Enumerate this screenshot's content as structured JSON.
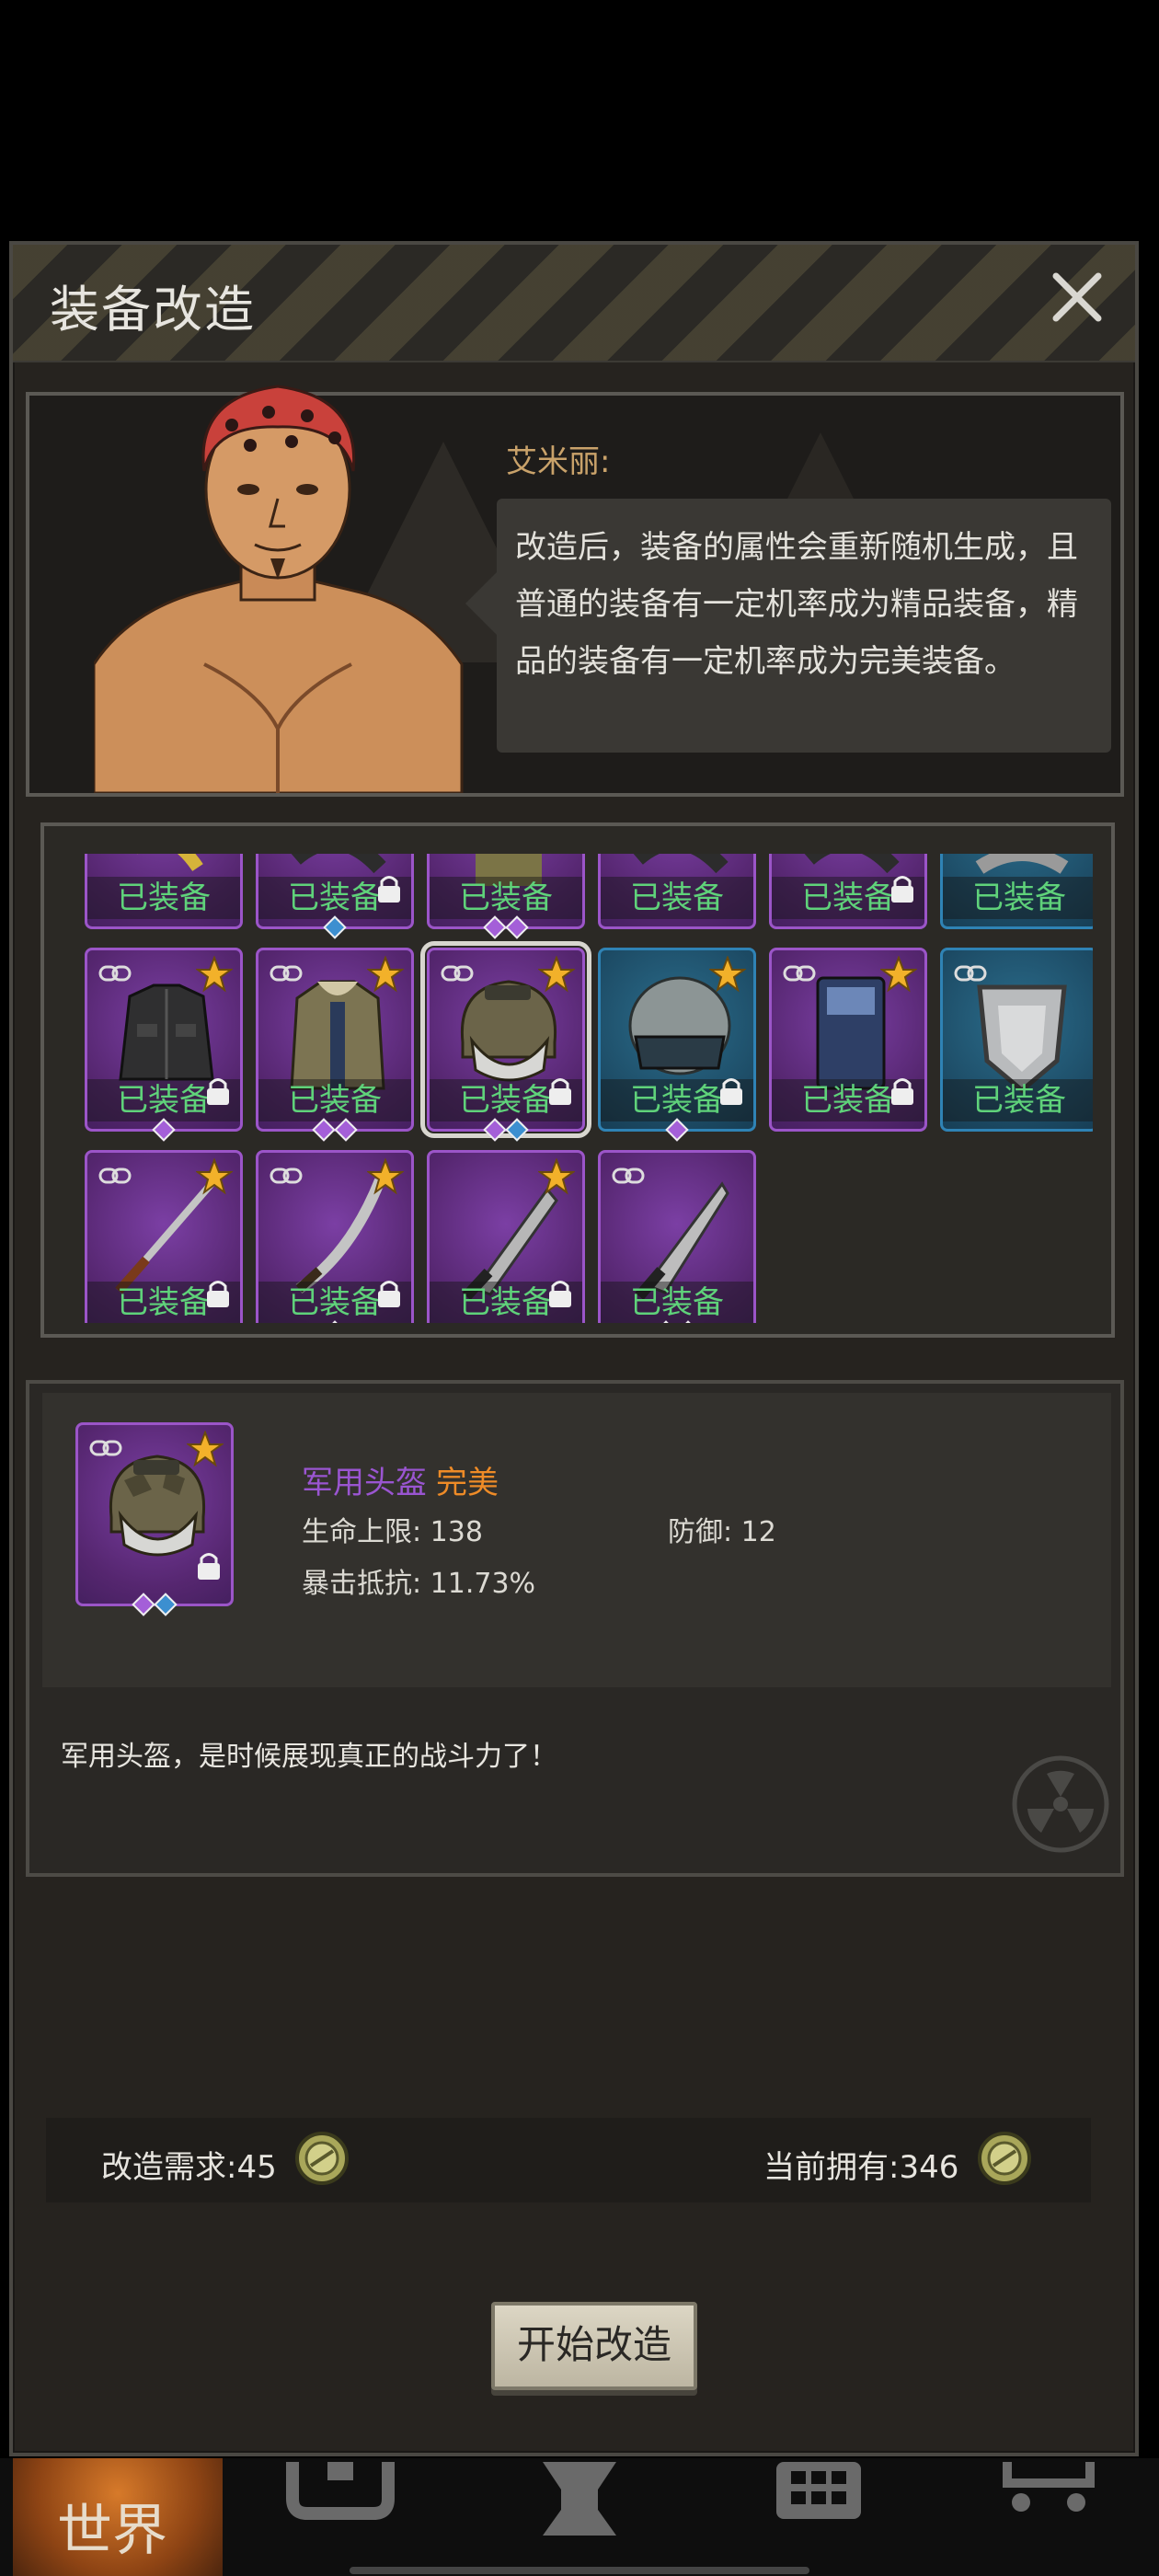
{
  "modal": {
    "title": "装备改造"
  },
  "npc": {
    "name": "艾米丽:",
    "dialogue_lines": [
      "改造后，装备的属性会重新随机生成，且",
      "普通的装备有一定机率成为精品装备，精",
      "品的装备有一定机率成为完美装备。"
    ]
  },
  "inventory": {
    "equipped_label": "已装备",
    "items": [
      {
        "icon": "gold-item-icon",
        "equipped": true,
        "rarity": "purple",
        "star": false,
        "link": false,
        "lock": false,
        "gems": []
      },
      {
        "icon": "dark-item-icon",
        "equipped": true,
        "rarity": "purple",
        "star": false,
        "link": false,
        "lock": true,
        "gems": [
          "blue"
        ]
      },
      {
        "icon": "olive-item-icon",
        "equipped": true,
        "rarity": "purple",
        "star": false,
        "link": false,
        "lock": false,
        "gems": [
          "purple",
          "purple"
        ]
      },
      {
        "icon": "dark-item-icon",
        "equipped": true,
        "rarity": "purple",
        "star": false,
        "link": false,
        "lock": false,
        "gems": []
      },
      {
        "icon": "dark-item-icon",
        "equipped": true,
        "rarity": "purple",
        "star": false,
        "link": false,
        "lock": true,
        "gems": []
      },
      {
        "icon": "grey-item-icon",
        "equipped": true,
        "rarity": "blue",
        "star": false,
        "link": false,
        "lock": false,
        "gems": []
      },
      {
        "icon": "black-jacket-icon",
        "equipped": true,
        "rarity": "purple",
        "star": true,
        "link": true,
        "lock": true,
        "gems": [
          "purple"
        ]
      },
      {
        "icon": "parka-coat-icon",
        "equipped": true,
        "rarity": "purple",
        "star": true,
        "link": true,
        "lock": false,
        "gems": [
          "purple",
          "purple"
        ]
      },
      {
        "icon": "military-helmet-icon",
        "equipped": true,
        "rarity": "purple",
        "star": true,
        "link": true,
        "lock": true,
        "gems": [
          "purple",
          "blue"
        ],
        "selected": true
      },
      {
        "icon": "riot-helmet-icon",
        "equipped": true,
        "rarity": "blue",
        "star": true,
        "link": false,
        "lock": true,
        "gems": [
          "purple"
        ]
      },
      {
        "icon": "riot-shield-icon",
        "equipped": true,
        "rarity": "purple",
        "star": true,
        "link": true,
        "lock": true,
        "gems": []
      },
      {
        "icon": "metal-shield-icon",
        "equipped": true,
        "rarity": "blue",
        "star": false,
        "link": true,
        "lock": false,
        "gems": []
      },
      {
        "icon": "katana-icon",
        "equipped": true,
        "rarity": "purple",
        "star": true,
        "link": true,
        "lock": true,
        "gems": []
      },
      {
        "icon": "sabre-icon",
        "equipped": true,
        "rarity": "purple",
        "star": true,
        "link": true,
        "lock": true,
        "gems": [
          "purple"
        ]
      },
      {
        "icon": "machete-icon",
        "equipped": true,
        "rarity": "purple",
        "star": true,
        "link": false,
        "lock": true,
        "gems": []
      },
      {
        "icon": "combat-knife-icon",
        "equipped": true,
        "rarity": "purple",
        "star": false,
        "link": true,
        "lock": false,
        "gems": [
          "purple",
          "purple"
        ]
      }
    ]
  },
  "selected_item": {
    "name": "军用头盔",
    "quality": "完美",
    "stats": {
      "hp_label": "生命上限:",
      "hp_value": "138",
      "def_label": "防御:",
      "def_value": "12",
      "crit_label": "暴击抵抗:",
      "crit_value": "11.73%"
    },
    "description": "军用头盔，是时候展现真正的战斗力了！",
    "colors": {
      "name": "#9a55d1",
      "quality": "#ee8b27"
    }
  },
  "cost": {
    "required_label": "改造需求:",
    "required_value": "45",
    "owned_label": "当前拥有:",
    "owned_value": "346"
  },
  "actions": {
    "start_label": "开始改造"
  },
  "bottom_nav": {
    "world_label": "世界"
  }
}
